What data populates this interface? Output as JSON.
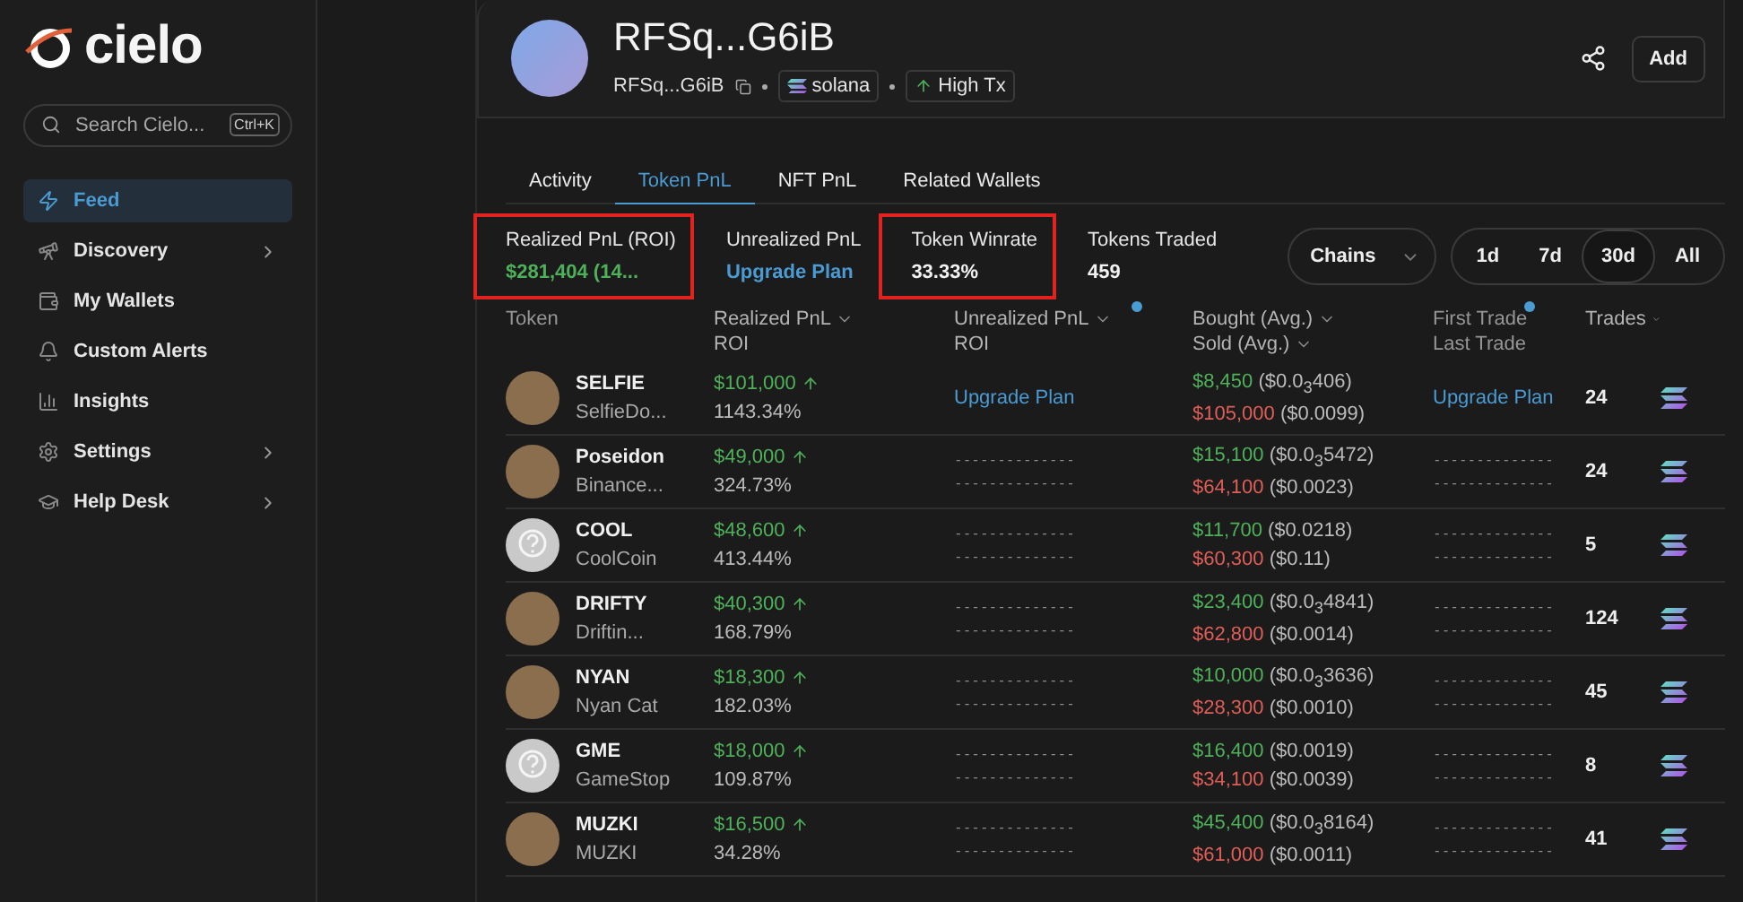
{
  "sidebar": {
    "logo": "cielo",
    "search": {
      "placeholder": "Search Cielo...",
      "shortcut": "Ctrl+K"
    },
    "items": [
      {
        "label": "Feed",
        "selected": true,
        "has_submenu": false
      },
      {
        "label": "Discovery",
        "selected": false,
        "has_submenu": true
      },
      {
        "label": "My Wallets",
        "selected": false,
        "has_submenu": false
      },
      {
        "label": "Custom Alerts",
        "selected": false,
        "has_submenu": false
      },
      {
        "label": "Insights",
        "selected": false,
        "has_submenu": false
      },
      {
        "label": "Settings",
        "selected": false,
        "has_submenu": true
      },
      {
        "label": "Help Desk",
        "selected": false,
        "has_submenu": true
      }
    ]
  },
  "profile": {
    "title": "RFSq...G6iB",
    "address": "RFSq...G6iB",
    "chain": "solana",
    "tag": "High Tx",
    "add_button": "Add"
  },
  "tabs": [
    {
      "label": "Activity",
      "selected": false
    },
    {
      "label": "Token PnL",
      "selected": true
    },
    {
      "label": "NFT PnL",
      "selected": false
    },
    {
      "label": "Related Wallets",
      "selected": false
    }
  ],
  "stats": [
    {
      "label": "Realized PnL (ROI)",
      "value": "$281,404 (14...",
      "kind": "positive",
      "highlighted": true
    },
    {
      "label": "Unrealized PnL",
      "value": "Upgrade Plan",
      "kind": "link",
      "highlighted": false
    },
    {
      "label": "Token Winrate",
      "value": "33.33%",
      "kind": "plain",
      "highlighted": true
    },
    {
      "label": "Tokens Traded",
      "value": "459",
      "kind": "plain",
      "highlighted": false
    }
  ],
  "chains_dropdown": "Chains",
  "periods": [
    {
      "label": "1d",
      "selected": false
    },
    {
      "label": "7d",
      "selected": false
    },
    {
      "label": "30d",
      "selected": true
    },
    {
      "label": "All",
      "selected": false
    }
  ],
  "table": {
    "columns": [
      {
        "lines": [
          "Token"
        ],
        "sortable": false,
        "dot": false
      },
      {
        "lines": [
          "Realized PnL",
          "ROI"
        ],
        "sortable": true,
        "dot": false
      },
      {
        "lines": [
          "Unrealized PnL",
          "ROI"
        ],
        "sortable": true,
        "dot": true
      },
      {
        "lines": [
          "Bought (Avg.)",
          "Sold (Avg.)"
        ],
        "sortable": true,
        "dot": false
      },
      {
        "lines": [
          "First Trade",
          "Last Trade"
        ],
        "sortable": false,
        "dot": true
      },
      {
        "lines": [
          "Trades"
        ],
        "sortable": true,
        "dot": false
      }
    ],
    "rows": [
      {
        "kind": "photo",
        "symbol": "SELFIE",
        "name": "SelfieDo...",
        "pnl": "$101,000",
        "roi": "1143.34%",
        "unrealized": {
          "kind": "link",
          "lines": [
            "Upgrade Plan"
          ]
        },
        "bought": {
          "amount": "$8,450",
          "lead": "($0.0",
          "zeros": "3",
          "tail": "406)"
        },
        "sold": {
          "amount": "$105,000",
          "lead": "($0.0099)"
        },
        "trade_times": {
          "kind": "link",
          "lines": [
            "Upgrade Plan"
          ]
        },
        "trades": "24"
      },
      {
        "kind": "photo",
        "symbol": "Poseidon",
        "name": "Binance...",
        "pnl": "$49,000",
        "roi": "324.73%",
        "unrealized": {
          "kind": "hidden",
          "lines": [
            "--------------",
            "--------------"
          ]
        },
        "bought": {
          "amount": "$15,100",
          "lead": "($0.0",
          "zeros": "3",
          "tail": "5472)"
        },
        "sold": {
          "amount": "$64,100",
          "lead": "($0.0023)"
        },
        "trade_times": {
          "kind": "hidden",
          "lines": [
            "--------------",
            "--------------"
          ]
        },
        "trades": "24"
      },
      {
        "kind": "unknown",
        "symbol": "COOL",
        "name": "CoolCoin",
        "pnl": "$48,600",
        "roi": "413.44%",
        "unrealized": {
          "kind": "hidden",
          "lines": [
            "--------------",
            "--------------"
          ]
        },
        "bought": {
          "amount": "$11,700",
          "lead": "($0.0218)"
        },
        "sold": {
          "amount": "$60,300",
          "lead": "($0.11)"
        },
        "trade_times": {
          "kind": "hidden",
          "lines": [
            "--------------",
            "--------------"
          ]
        },
        "trades": "5"
      },
      {
        "kind": "photo",
        "symbol": "DRIFTY",
        "name": "Driftin...",
        "pnl": "$40,300",
        "roi": "168.79%",
        "unrealized": {
          "kind": "hidden",
          "lines": [
            "--------------",
            "--------------"
          ]
        },
        "bought": {
          "amount": "$23,400",
          "lead": "($0.0",
          "zeros": "3",
          "tail": "4841)"
        },
        "sold": {
          "amount": "$62,800",
          "lead": "($0.0014)"
        },
        "trade_times": {
          "kind": "hidden",
          "lines": [
            "--------------",
            "--------------"
          ]
        },
        "trades": "124"
      },
      {
        "kind": "photo",
        "symbol": "NYAN",
        "name": "Nyan Cat",
        "pnl": "$18,300",
        "roi": "182.03%",
        "unrealized": {
          "kind": "hidden",
          "lines": [
            "--------------",
            "--------------"
          ]
        },
        "bought": {
          "amount": "$10,000",
          "lead": "($0.0",
          "zeros": "3",
          "tail": "3636)"
        },
        "sold": {
          "amount": "$28,300",
          "lead": "($0.0010)"
        },
        "trade_times": {
          "kind": "hidden",
          "lines": [
            "--------------",
            "--------------"
          ]
        },
        "trades": "45"
      },
      {
        "kind": "unknown",
        "symbol": "GME",
        "name": "GameStop",
        "pnl": "$18,000",
        "roi": "109.87%",
        "unrealized": {
          "kind": "hidden",
          "lines": [
            "--------------",
            "--------------"
          ]
        },
        "bought": {
          "amount": "$16,400",
          "lead": "($0.0019)"
        },
        "sold": {
          "amount": "$34,100",
          "lead": "($0.0039)"
        },
        "trade_times": {
          "kind": "hidden",
          "lines": [
            "--------------",
            "--------------"
          ]
        },
        "trades": "8"
      },
      {
        "kind": "photo",
        "symbol": "MUZKI",
        "name": "MUZKI",
        "pnl": "$16,500",
        "roi": "34.28%",
        "unrealized": {
          "kind": "hidden",
          "lines": [
            "--------------",
            "--------------"
          ]
        },
        "bought": {
          "amount": "$45,400",
          "lead": "($0.0",
          "zeros": "3",
          "tail": "8164)"
        },
        "sold": {
          "amount": "$61,000",
          "lead": "($0.0011)"
        },
        "trade_times": {
          "kind": "hidden",
          "lines": [
            "--------------",
            "--------------"
          ]
        },
        "trades": "41"
      }
    ]
  }
}
